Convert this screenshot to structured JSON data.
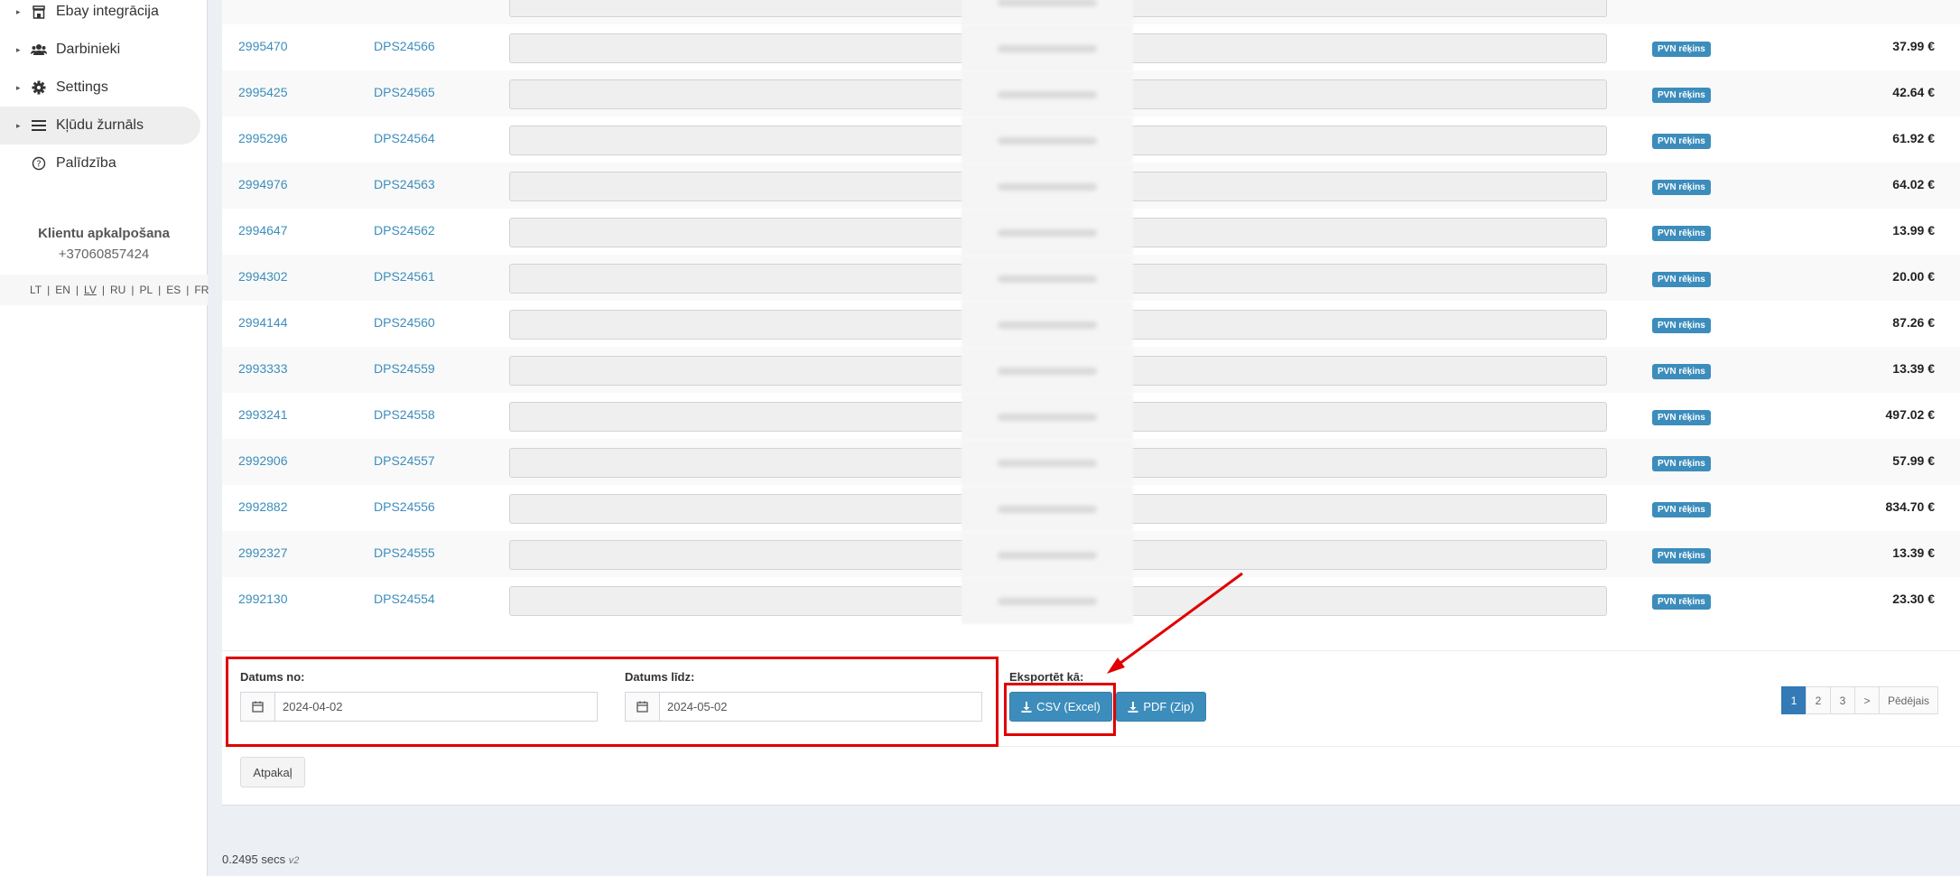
{
  "sidebar": {
    "items": [
      {
        "label": "Ebay integrācija",
        "icon": "store-icon",
        "caret": true
      },
      {
        "label": "Darbinieki",
        "icon": "users-icon",
        "caret": true
      },
      {
        "label": "Settings",
        "icon": "gear-icon",
        "caret": true
      },
      {
        "label": "Kļūdu žurnāls",
        "icon": "list-icon",
        "caret": true,
        "active": true
      },
      {
        "label": "Palīdzība",
        "icon": "help-circle-icon",
        "caret": false
      }
    ],
    "support_title": "Klientu apkalpošana",
    "support_phone": "+37060857424",
    "languages": [
      "LT",
      "EN",
      "LV",
      "RU",
      "PL",
      "ES",
      "FR"
    ],
    "current_language": "LV"
  },
  "table": {
    "rows": [
      {
        "id": "2995470",
        "num": "DPS24566",
        "badge": "PVN rēķins",
        "amount": "37.99 €"
      },
      {
        "id": "2995425",
        "num": "DPS24565",
        "badge": "PVN rēķins",
        "amount": "42.64 €"
      },
      {
        "id": "2995296",
        "num": "DPS24564",
        "badge": "PVN rēķins",
        "amount": "61.92 €"
      },
      {
        "id": "2994976",
        "num": "DPS24563",
        "badge": "PVN rēķins",
        "amount": "64.02 €"
      },
      {
        "id": "2994647",
        "num": "DPS24562",
        "badge": "PVN rēķins",
        "amount": "13.99 €"
      },
      {
        "id": "2994302",
        "num": "DPS24561",
        "badge": "PVN rēķins",
        "amount": "20.00 €"
      },
      {
        "id": "2994144",
        "num": "DPS24560",
        "badge": "PVN rēķins",
        "amount": "87.26 €"
      },
      {
        "id": "2993333",
        "num": "DPS24559",
        "badge": "PVN rēķins",
        "amount": "13.39 €"
      },
      {
        "id": "2993241",
        "num": "DPS24558",
        "badge": "PVN rēķins",
        "amount": "497.02 €"
      },
      {
        "id": "2992906",
        "num": "DPS24557",
        "badge": "PVN rēķins",
        "amount": "57.99 €"
      },
      {
        "id": "2992882",
        "num": "DPS24556",
        "badge": "PVN rēķins",
        "amount": "834.70 €"
      },
      {
        "id": "2992327",
        "num": "DPS24555",
        "badge": "PVN rēķins",
        "amount": "13.39 €"
      },
      {
        "id": "2992130",
        "num": "DPS24554",
        "badge": "PVN rēķins",
        "amount": "23.30 €"
      }
    ]
  },
  "filters": {
    "date_from_label": "Datums no:",
    "date_from_value": "2024-04-02",
    "date_to_label": "Datums līdz:",
    "date_to_value": "2024-05-02"
  },
  "export": {
    "label": "Eksportēt kā:",
    "csv_label": "CSV (Excel)",
    "pdf_label": "PDF (Zip)"
  },
  "pagination": {
    "pages": [
      "1",
      "2",
      "3",
      ">",
      "Pēdējais"
    ],
    "current": "1"
  },
  "back_label": "Atpakaļ",
  "footer": {
    "time": "0.2495 secs",
    "version": "v2"
  },
  "colors": {
    "accent": "#3c8dbc",
    "annotation": "#e00000"
  }
}
